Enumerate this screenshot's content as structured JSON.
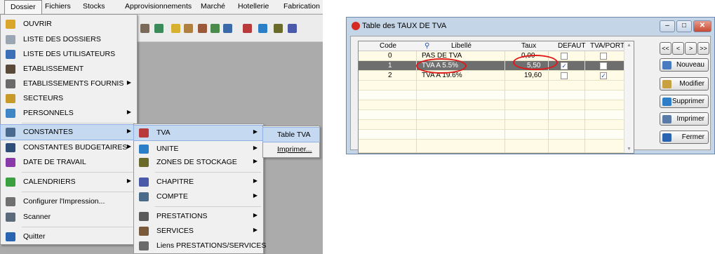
{
  "menubar": {
    "items": [
      "Dossier",
      "Fichiers",
      "Stocks",
      "Approvisionnements",
      "Marché",
      "Hotellerie",
      "Fabrication"
    ]
  },
  "menu_dossier": {
    "items": [
      {
        "label": "OUVRIR",
        "icon": "folder-open-icon",
        "color": "#d9a62a"
      },
      {
        "label": "LISTE DES DOSSIERS",
        "icon": "list-icon",
        "color": "#9aa6b2"
      },
      {
        "label": "LISTE DES UTILISATEURS",
        "icon": "users-icon",
        "color": "#3c6fb8"
      },
      {
        "label": "ETABLISSEMENT",
        "icon": "building-icon",
        "color": "#5a4a3a"
      },
      {
        "label": "ETABLISSEMENTS FOURNIS",
        "icon": "cart-icon",
        "color": "#6a6a6a"
      },
      {
        "label": "SECTEURS",
        "icon": "sectors-icon",
        "color": "#c89a2a"
      },
      {
        "label": "PERSONNELS",
        "icon": "person-icon",
        "color": "#3f86c6"
      },
      {
        "label": "CONSTANTES",
        "icon": "constants-icon",
        "color": "#4a6a90"
      },
      {
        "label": "CONSTANTES BUDGETAIRES",
        "icon": "budget-icon",
        "color": "#2e4e7a"
      },
      {
        "label": "DATE DE TRAVAIL",
        "icon": "calendar-icon",
        "color": "#8a3aa8"
      },
      {
        "label": "CALENDRIERS",
        "icon": "calendars-icon",
        "color": "#3aa040"
      },
      {
        "label": "Configurer l'Impression...",
        "icon": "printer-setup-icon",
        "color": "#707070"
      },
      {
        "label": "Scanner",
        "icon": "scanner-icon",
        "color": "#5a6a7a"
      },
      {
        "label": "Quitter",
        "icon": "exit-icon",
        "color": "#2a64b0"
      }
    ]
  },
  "menu_constantes": {
    "items": [
      {
        "label": "TVA",
        "icon": "tva-icon",
        "color": "#b83a3a"
      },
      {
        "label": "UNITE",
        "icon": "unit-icon",
        "color": "#2a7fc6"
      },
      {
        "label": "ZONES DE STOCKAGE",
        "icon": "storage-icon",
        "color": "#6a6a2a"
      },
      {
        "label": "CHAPITRE",
        "icon": "chapter-icon",
        "color": "#4a5aa8"
      },
      {
        "label": "COMPTE",
        "icon": "account-icon",
        "color": "#4a6a8a"
      },
      {
        "label": "PRESTATIONS",
        "icon": "services-icon",
        "color": "#5a5a5a"
      },
      {
        "label": "SERVICES",
        "icon": "tools-icon",
        "color": "#7a5a3a"
      },
      {
        "label": "Liens PRESTATIONS/SERVICES",
        "icon": "link-icon",
        "color": "#6a6a6a"
      }
    ]
  },
  "menu_tva": {
    "items": [
      "Table TVA",
      "Imprimer..."
    ]
  },
  "dialog": {
    "title": "Table des TAUX DE TVA",
    "columns": [
      "Code",
      "Libellé",
      "Taux",
      "DEFAUT",
      "TVA/PORT"
    ],
    "rows": [
      {
        "code": "0",
        "libelle": "PAS DE TVA",
        "taux": "0,00",
        "defaut": false,
        "port": false
      },
      {
        "code": "1",
        "libelle": "TVA A 5.5%",
        "taux": "5,50",
        "defaut": true,
        "port": false
      },
      {
        "code": "2",
        "libelle": "TVA A 19.6%",
        "taux": "19,60",
        "defaut": false,
        "port": true
      }
    ],
    "selected_row": 1,
    "nav": [
      "<<",
      "<",
      ">",
      ">>"
    ],
    "buttons": [
      {
        "label": "Nouveau",
        "icon": "new-icon",
        "color": "#4a7abf"
      },
      {
        "label": "Modifier",
        "icon": "edit-icon",
        "color": "#c8a040"
      },
      {
        "label": "Supprimer",
        "icon": "delete-icon",
        "color": "#2e7ec8"
      },
      {
        "label": "Imprimer",
        "icon": "print-icon",
        "color": "#5a7aa8"
      },
      {
        "label": "Fermer",
        "icon": "exit-icon",
        "color": "#2a64b0"
      }
    ]
  }
}
